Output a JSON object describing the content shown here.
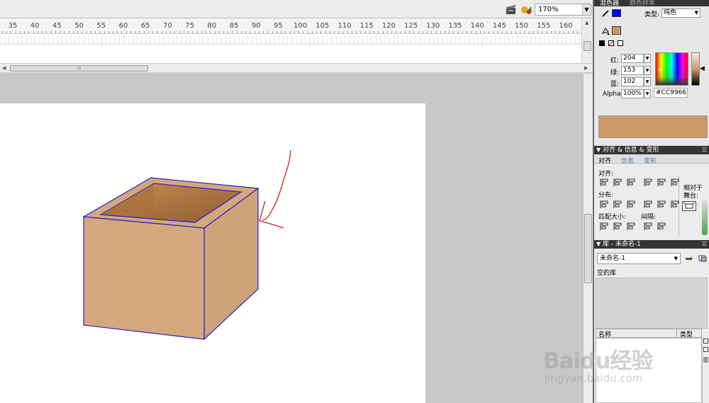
{
  "toolbar": {
    "edit_scene_icon": "clapper-icon",
    "edit_symbol_icon": "symbol-icon",
    "zoom_value": "170%"
  },
  "timeline": {
    "ruler_numbers": [
      "35",
      "40",
      "45",
      "50",
      "55",
      "60",
      "65",
      "70",
      "75",
      "80",
      "85",
      "90",
      "95",
      "100",
      "105",
      "110",
      "115",
      "120",
      "125",
      "130",
      "135",
      "140",
      "145",
      "150",
      "155",
      "160"
    ],
    "hscroll_grip": "III"
  },
  "color_panel": {
    "tab_mixer": "混色器",
    "tab_swatches": "颜色样本",
    "type_label": "类型:",
    "type_value": "纯色",
    "red_label": "红:",
    "red_value": "204",
    "green_label": "绿:",
    "green_value": "153",
    "blue_label": "蓝:",
    "blue_value": "102",
    "alpha_label": "Alpha:",
    "alpha_value": "100%",
    "hex_value": "#CC9966",
    "stroke_color": "#0000ff",
    "fill_color": "#cc9966"
  },
  "align_panel": {
    "title": "对齐 & 信息 & 变形",
    "tab_align": "对齐",
    "tab_info": "信息",
    "tab_transform": "变形",
    "section_align": "对齐:",
    "section_distribute": "分布:",
    "section_match_size": "匹配大小:",
    "section_spacing": "间隔:",
    "relative_stage_1": "相对于",
    "relative_stage_2": "舞台:"
  },
  "library_panel": {
    "title": "库 - 未命名-1",
    "doc_select": "未命名-1",
    "empty_text": "空的库",
    "col_name": "名称",
    "col_type": "类型"
  },
  "watermark": {
    "brand": "Baidu经验",
    "url": "jingyan.baidu.com"
  },
  "colors": {
    "box_front": "#d4a87c",
    "box_inner": "#b27a46",
    "box_outline": "#2a1fcf",
    "stroke_annotation": "#cc2020"
  }
}
